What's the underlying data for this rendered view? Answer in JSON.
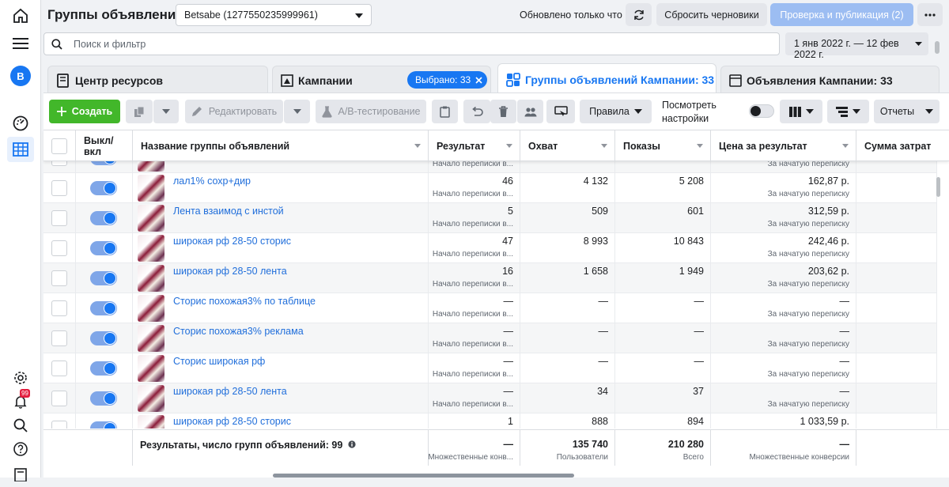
{
  "rail": {
    "avatar_letter": "B",
    "notifications_count": "99"
  },
  "header": {
    "title": "Группы объявлений",
    "account": "Betsabe (1277550235999961)",
    "updated": "Обновлено только что",
    "discard_label": "Сбросить черновики",
    "publish_label": "Проверка и публикация (2)"
  },
  "search": {
    "placeholder": "Поиск и фильтр",
    "date_range": "1 янв 2022 г. — 12 фев 2022 г."
  },
  "tabs": {
    "resources": "Центр ресурсов",
    "campaigns": "Кампании",
    "selected_chip": "Выбрано: 33",
    "adsets": "Группы объявлений Кампании: 33",
    "ads": "Объявления Кампании: 33"
  },
  "toolbar": {
    "create": "Создать",
    "edit": "Редактировать",
    "abtest": "A/B-тестирование",
    "rules": "Правила",
    "view_settings_line1": "Посмотреть",
    "view_settings_line2": "настройки",
    "reports": "Отчеты"
  },
  "columns": {
    "toggle": "Выкл/ вкл",
    "name": "Название группы объявлений",
    "result": "Результат",
    "reach": "Охват",
    "impressions": "Показы",
    "cost_per_result": "Цена за результат",
    "spend": "Сумма затрат"
  },
  "rows": [
    {
      "name": "",
      "result": "",
      "result_sub": "Начало переписки в...",
      "reach": "",
      "impressions": "",
      "cpr": "",
      "cpr_sub": "За начатую переписку",
      "partial": true
    },
    {
      "name": "лал1% сохр+дир",
      "result": "46",
      "result_sub": "Начало переписки в...",
      "reach": "4 132",
      "impressions": "5 208",
      "cpr": "162,87 р.",
      "cpr_sub": "За начатую переписку"
    },
    {
      "name": "Лента взаимод с инстой",
      "result": "5",
      "result_sub": "Начало переписки в...",
      "reach": "509",
      "impressions": "601",
      "cpr": "312,59 р.",
      "cpr_sub": "За начатую переписку"
    },
    {
      "name": "широкая рф 28-50 сторис",
      "result": "47",
      "result_sub": "Начало переписки в...",
      "reach": "8 993",
      "impressions": "10 843",
      "cpr": "242,46 р.",
      "cpr_sub": "За начатую переписку"
    },
    {
      "name": "широкая рф 28-50 лента",
      "result": "16",
      "result_sub": "Начало переписки в...",
      "reach": "1 658",
      "impressions": "1 949",
      "cpr": "203,62 р.",
      "cpr_sub": "За начатую переписку"
    },
    {
      "name": "Сторис похожая3% по таблице",
      "result": "—",
      "result_sub": "Начало переписки в...",
      "reach": "—",
      "impressions": "—",
      "cpr": "—",
      "cpr_sub": "За начатую переписку"
    },
    {
      "name": "Сторис похожая3% реклама",
      "result": "—",
      "result_sub": "Начало переписки в...",
      "reach": "—",
      "impressions": "—",
      "cpr": "—",
      "cpr_sub": "За начатую переписку"
    },
    {
      "name": "Сторис широкая рф",
      "result": "—",
      "result_sub": "Начало переписки в...",
      "reach": "—",
      "impressions": "—",
      "cpr": "—",
      "cpr_sub": "За начатую переписку"
    },
    {
      "name": "широкая рф 28-50 лента",
      "result": "—",
      "result_sub": "Начало переписки в...",
      "reach": "34",
      "impressions": "37",
      "cpr": "—",
      "cpr_sub": "За начатую переписку"
    },
    {
      "name": "широкая рф 28-50 сторис",
      "result": "1",
      "result_sub": "",
      "reach": "888",
      "impressions": "894",
      "cpr": "1 033,59 р.",
      "cpr_sub": ""
    }
  ],
  "summary": {
    "label": "Результаты, число групп объявлений: 99",
    "result": "—",
    "result_sub": "Множественные конв...",
    "reach": "135 740",
    "reach_sub": "Пользователи",
    "impressions": "210 280",
    "impressions_sub": "Всего",
    "cpr": "—",
    "cpr_sub": "Множественные конверсии"
  },
  "colors": {
    "accent": "#1877f2",
    "create_green": "#42b72a",
    "link_blue": "#216fdb"
  }
}
